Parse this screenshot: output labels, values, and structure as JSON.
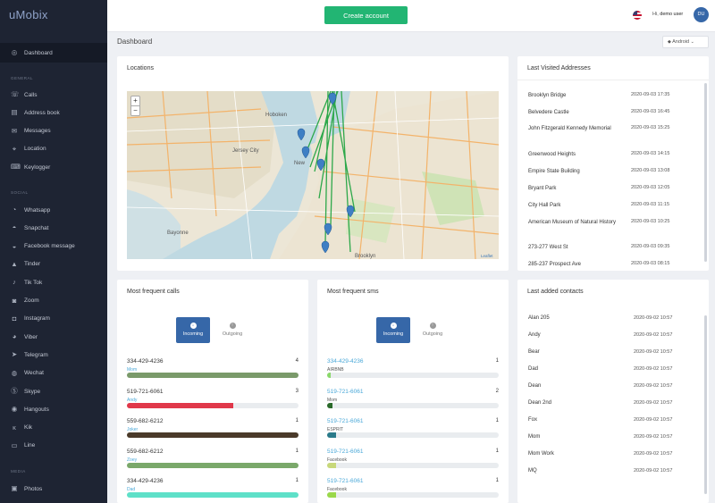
{
  "app": {
    "logo": "uMobix"
  },
  "sidebar": {
    "dashboard": "Dashboard",
    "section_general": "GENERAL",
    "general": [
      {
        "label": "Calls",
        "icon": "phone-icon"
      },
      {
        "label": "Address book",
        "icon": "address-book-icon"
      },
      {
        "label": "Messages",
        "icon": "message-icon"
      },
      {
        "label": "Location",
        "icon": "location-icon"
      },
      {
        "label": "Keylogger",
        "icon": "keyboard-icon"
      }
    ],
    "section_social": "SOCIAL",
    "social": [
      {
        "label": "Whatsapp",
        "icon": "whatsapp-icon"
      },
      {
        "label": "Snapchat",
        "icon": "snapchat-icon"
      },
      {
        "label": "Facebook message",
        "icon": "facebook-icon"
      },
      {
        "label": "Tinder",
        "icon": "tinder-icon"
      },
      {
        "label": "Tik Tok",
        "icon": "tiktok-icon"
      },
      {
        "label": "Zoom",
        "icon": "zoom-icon"
      },
      {
        "label": "Instagram",
        "icon": "instagram-icon"
      },
      {
        "label": "Viber",
        "icon": "viber-icon"
      },
      {
        "label": "Telegram",
        "icon": "telegram-icon"
      },
      {
        "label": "Wechat",
        "icon": "wechat-icon"
      },
      {
        "label": "Skype",
        "icon": "skype-icon"
      },
      {
        "label": "Hangouts",
        "icon": "hangouts-icon"
      },
      {
        "label": "Kik",
        "icon": "kik-icon"
      },
      {
        "label": "Line",
        "icon": "line-icon"
      }
    ],
    "section_media": "MEDIA",
    "media": [
      {
        "label": "Photos",
        "icon": "photo-icon"
      }
    ]
  },
  "topbar": {
    "create_label": "Create account",
    "greeting": "Hi,",
    "user": "demo user",
    "avatar": "DU"
  },
  "page": {
    "title": "Dashboard",
    "device": "Android"
  },
  "locations": {
    "title": "Locations",
    "map_labels": [
      "Hoboken",
      "Jersey City",
      "New",
      "Bayonne",
      "Brooklyn",
      "Leaflet"
    ],
    "zoom_in": "+",
    "zoom_out": "−"
  },
  "visited": {
    "title": "Last Visited Addresses",
    "items": [
      {
        "name": "Brooklyn Bridge",
        "time": "2020-09-03 17:35"
      },
      {
        "name": "Belvedere Castle",
        "time": "2020-09-03 16:45"
      },
      {
        "name": "John Fitzgerald Kennedy Memorial",
        "time": "2020-09-03 15:25"
      },
      {
        "name": "Greenwood Heights",
        "time": "2020-09-03 14:15"
      },
      {
        "name": "Empire State Building",
        "time": "2020-09-03 13:08"
      },
      {
        "name": "Bryant Park",
        "time": "2020-09-03 12:05"
      },
      {
        "name": "City Hall Park",
        "time": "2020-09-03 11:15"
      },
      {
        "name": "American Museum of Natural History",
        "time": "2020-09-03 10:25"
      },
      {
        "name": "273-277 West St",
        "time": "2020-09-03 09:35"
      },
      {
        "name": "285-237 Prospect Ave",
        "time": "2020-09-03 08:15"
      }
    ]
  },
  "calls": {
    "title": "Most frequent calls",
    "tab_in": "Incoming",
    "tab_out": "Outgoing",
    "items": [
      {
        "number": "334-429-4236",
        "name": "Mom",
        "count": "4",
        "level": 1.0,
        "color": "#7a9a6a"
      },
      {
        "number": "519-721-6061",
        "name": "Andy",
        "count": "3",
        "level": 0.62,
        "color": "#e0384a"
      },
      {
        "number": "559-682-6212",
        "name": "Joker",
        "count": "1",
        "level": 1.0,
        "color": "#4a3a2a"
      },
      {
        "number": "559-682-6212",
        "name": "Zoey",
        "count": "1",
        "level": 1.0,
        "color": "#7aa86a"
      },
      {
        "number": "334-429-4236",
        "name": "Dad",
        "count": "1",
        "level": 1.0,
        "color": "#5ee0c8"
      }
    ]
  },
  "sms": {
    "title": "Most frequent sms",
    "tab_in": "Incoming",
    "tab_out": "Outgoing",
    "items": [
      {
        "number": "334-429-4236",
        "name": "AIRBNB",
        "count": "1",
        "level": 0.02,
        "color": "#8ad86a"
      },
      {
        "number": "519-721-6061",
        "name": "Mom",
        "count": "2",
        "level": 0.03,
        "color": "#2a6a2a"
      },
      {
        "number": "519-721-6061",
        "name": "ESPRIT",
        "count": "1",
        "level": 0.05,
        "color": "#2a7a8a"
      },
      {
        "number": "519-721-6061",
        "name": "Facebook",
        "count": "1",
        "level": 0.05,
        "color": "#c8d87a"
      },
      {
        "number": "519-721-6061",
        "name": "Facebook",
        "count": "1",
        "level": 0.05,
        "color": "#9ad84a"
      }
    ]
  },
  "contacts": {
    "title": "Last added contacts",
    "items": [
      {
        "name": "Alan 205",
        "time": "2020-09-02 10:57"
      },
      {
        "name": "Andy",
        "time": "2020-09-02 10:57"
      },
      {
        "name": "Bear",
        "time": "2020-09-02 10:57"
      },
      {
        "name": "Dad",
        "time": "2020-09-02 10:57"
      },
      {
        "name": "Dean",
        "time": "2020-09-02 10:57"
      },
      {
        "name": "Dean 2nd",
        "time": "2020-09-02 10:57"
      },
      {
        "name": "Fox",
        "time": "2020-09-02 10:57"
      },
      {
        "name": "Mom",
        "time": "2020-09-02 10:57"
      },
      {
        "name": "Mom Work",
        "time": "2020-09-02 10:57"
      },
      {
        "name": "MQ",
        "time": "2020-09-02 10:57"
      }
    ]
  }
}
